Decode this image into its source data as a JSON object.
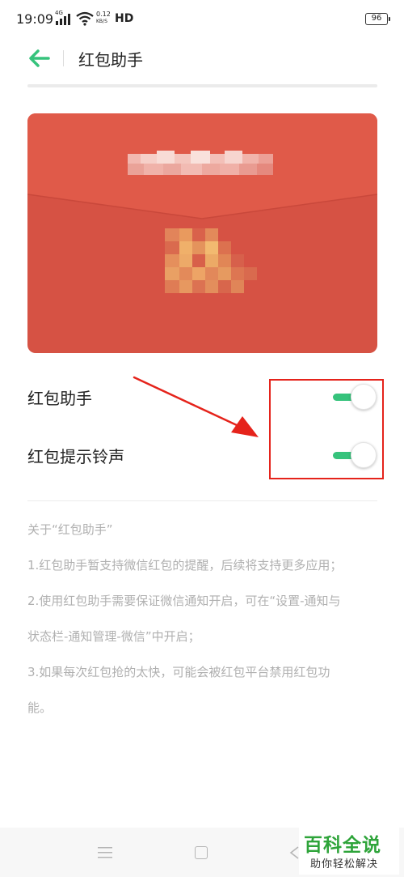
{
  "status_bar": {
    "time": "19:09",
    "network": "4G",
    "speed_value": "0.12",
    "speed_unit": "KB/S",
    "hd": "HD",
    "battery": "96"
  },
  "header": {
    "title": "红包助手",
    "accent_color": "#36c37c"
  },
  "envelope": {
    "color": "#d65244"
  },
  "settings": [
    {
      "label": "红包助手",
      "enabled": true
    },
    {
      "label": "红包提示铃声",
      "enabled": true
    }
  ],
  "about": {
    "heading": "关于“红包助手”",
    "line1": "1.红包助手暂支持微信红包的提醒，后续将支持更多应用；",
    "line2a": "2.使用红包助手需要保证微信通知开启，可在“设置-通知与",
    "line2b": "状态栏-通知管理-微信”中开启；",
    "line3a": "3.如果每次红包抢的太快，可能会被红包平台禁用红包功",
    "line3b": "能。"
  },
  "watermark": {
    "main": "百科全说",
    "sub": "助你轻松解决"
  }
}
